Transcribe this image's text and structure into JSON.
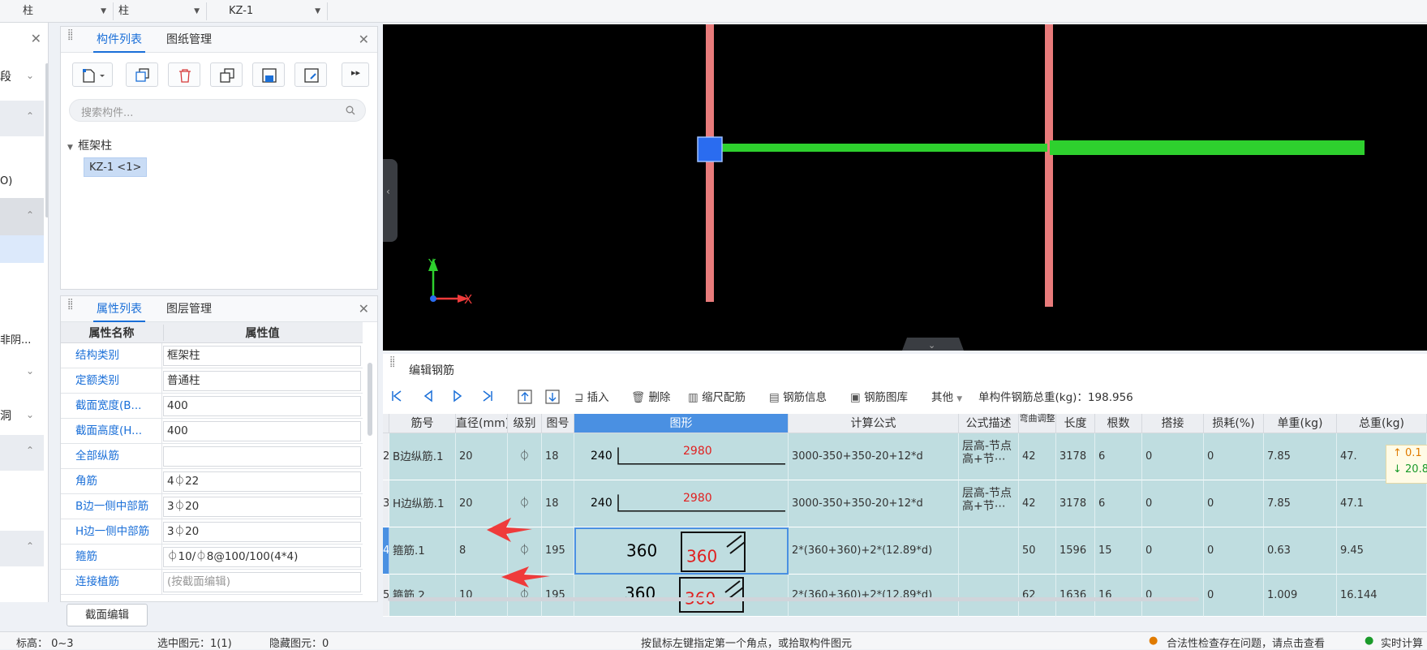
{
  "topbar": {
    "dropdowns": [
      "柱",
      "柱",
      "KZ-1"
    ]
  },
  "leftstrip": {
    "items": [
      "段",
      "O)",
      "非阴...",
      "洞"
    ]
  },
  "component_panel": {
    "tabs": [
      "构件列表",
      "图纸管理"
    ],
    "search_placeholder": "搜索构件...",
    "tree_group": "框架柱",
    "tree_item": "KZ-1 <1>"
  },
  "property_panel": {
    "tabs": [
      "属性列表",
      "图层管理"
    ],
    "col_name": "属性名称",
    "col_value": "属性值",
    "rows": [
      {
        "name": "结构类别",
        "value": "框架柱"
      },
      {
        "name": "定额类别",
        "value": "普通柱"
      },
      {
        "name": "截面宽度(B...",
        "value": "400"
      },
      {
        "name": "截面高度(H...",
        "value": "400"
      },
      {
        "name": "全部纵筋",
        "value": ""
      },
      {
        "name": "角筋",
        "value": "4⏀22"
      },
      {
        "name": "B边一侧中部筋",
        "value": "3⏀20"
      },
      {
        "name": "H边一侧中部筋",
        "value": "3⏀20"
      },
      {
        "name": "箍筋",
        "value": "⏀10/⏀8@100/100(4*4)"
      },
      {
        "name": "连接植筋",
        "value": "(按截面编辑)"
      }
    ],
    "section_button": "截面编辑"
  },
  "viewport": {
    "axis_x": "X",
    "axis_y": "Y"
  },
  "rebar_panel": {
    "title": "编辑钢筋",
    "toolbar": {
      "insert": "插入",
      "delete": "删除",
      "scale": "缩尺配筋",
      "info": "钢筋信息",
      "library": "钢筋图库",
      "other": "其他",
      "total": "单构件钢筋总重(kg)：198.956"
    },
    "headers": [
      "筋号",
      "直径(mm)",
      "级别",
      "图号",
      "图形",
      "计算公式",
      "公式描述",
      "弯曲调整",
      "长度",
      "根数",
      "搭接",
      "损耗(%)",
      "单重(kg)",
      "总重(kg)"
    ],
    "rows": [
      {
        "idx": "2",
        "name": "B边纵筋.1",
        "dia": "20",
        "grade": "⏀",
        "fig": "18",
        "shape_left": "240",
        "shape_top": "2980",
        "formula": "3000-350+350-20+12*d",
        "desc": "层高-节点高+节⋯",
        "bend": "42",
        "len": "3178",
        "count": "6",
        "lap": "0",
        "loss": "0",
        "unit": "7.85",
        "total": "47."
      },
      {
        "idx": "3",
        "name": "H边纵筋.1",
        "dia": "20",
        "grade": "⏀",
        "fig": "18",
        "shape_left": "240",
        "shape_top": "2980",
        "formula": "3000-350+350-20+12*d",
        "desc": "层高-节点高+节⋯",
        "bend": "42",
        "len": "3178",
        "count": "6",
        "lap": "0",
        "loss": "0",
        "unit": "7.85",
        "total": "47.1"
      },
      {
        "idx": "4",
        "name": "箍筋.1",
        "dia": "8",
        "grade": "⏀",
        "fig": "195",
        "shape_left": "360",
        "shape_top": "360",
        "formula": "2*(360+360)+2*(12.89*d)",
        "desc": "",
        "bend": "50",
        "len": "1596",
        "count": "15",
        "lap": "0",
        "loss": "0",
        "unit": "0.63",
        "total": "9.45"
      },
      {
        "idx": "5",
        "name": "箍筋.2",
        "dia": "10",
        "grade": "⏀",
        "fig": "195",
        "shape_left": "360",
        "shape_top": "360",
        "formula": "2*(360+360)+2*(12.89*d)",
        "desc": "",
        "bend": "62",
        "len": "1636",
        "count": "16",
        "lap": "0",
        "loss": "0",
        "unit": "1.009",
        "total": "16.144"
      }
    ],
    "tooltip": [
      "↑ 0.1",
      "↓ 20.8"
    ]
  },
  "statusbar": {
    "elevation": "标高：  0~3",
    "selected": "选中图元：1(1)",
    "hidden": "隐藏图元：0",
    "hint": "按鼠标左键指定第一个角点，或拾取构件图元",
    "warning": "合法性检查存在问题，请点击查看",
    "realtime": "实时计算"
  },
  "colors": {
    "accent": "#1a6fd8",
    "beam": "#2ed02e",
    "column": "#e87b7b",
    "node": "#2a6cf0",
    "row_bg": "#bfdde0",
    "arrow": "#ef3b3b"
  }
}
